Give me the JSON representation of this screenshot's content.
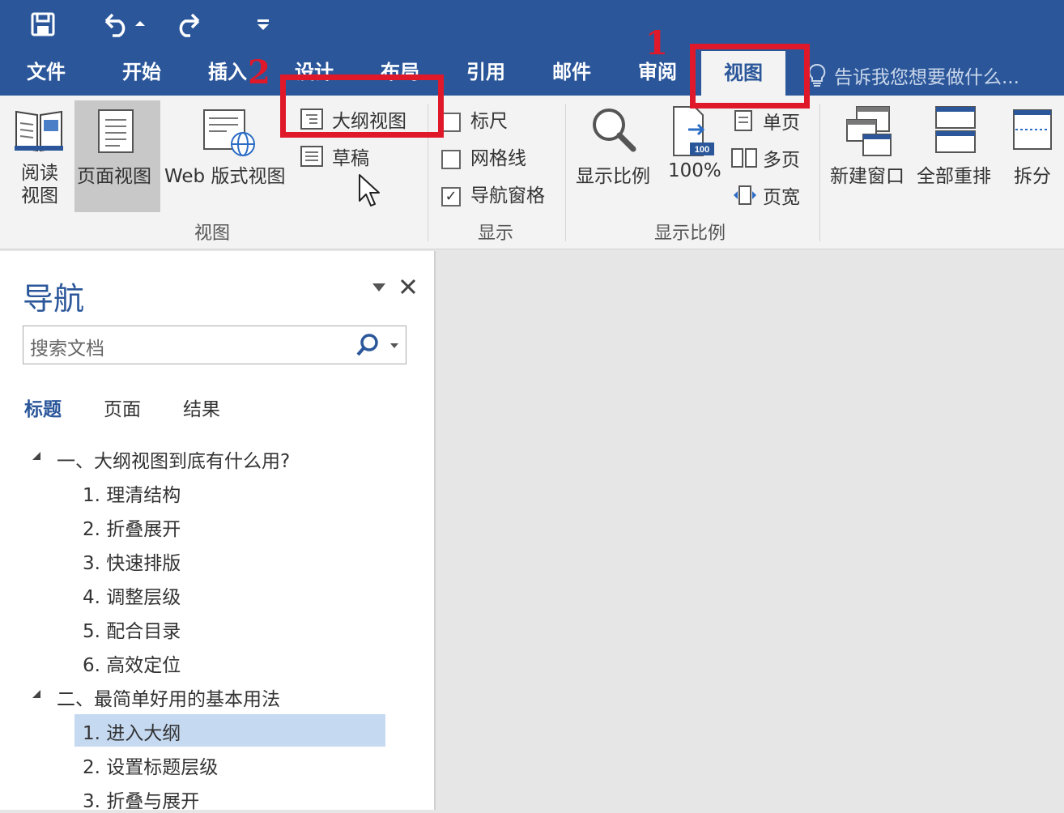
{
  "qat": {
    "save_icon": "save-icon",
    "undo_icon": "undo-icon",
    "redo_icon": "redo-icon",
    "customize_icon": "customize-icon"
  },
  "tabs": [
    {
      "label": "文件"
    },
    {
      "label": "开始"
    },
    {
      "label": "插入"
    },
    {
      "label": "设计"
    },
    {
      "label": "布局"
    },
    {
      "label": "引用"
    },
    {
      "label": "邮件"
    },
    {
      "label": "审阅"
    },
    {
      "label": "视图"
    }
  ],
  "tell_me": "告诉我您想要做什么...",
  "annotations": {
    "num1": "1",
    "num2": "2"
  },
  "ribbon": {
    "view_group": {
      "read_mode": [
        "阅读",
        "视图"
      ],
      "print_layout": "页面视图",
      "web_layout": "Web 版式视图",
      "outline": "大纲视图",
      "draft": "草稿",
      "label": "视图"
    },
    "show_group": {
      "ruler": "标尺",
      "gridlines": "网格线",
      "nav_pane": "导航窗格",
      "label": "显示"
    },
    "zoom_group": {
      "zoom": "显示比例",
      "zoom100": "100%",
      "zoom100_badge": "100",
      "one_page": "单页",
      "multi_page": "多页",
      "page_width": "页宽",
      "label": "显示比例"
    },
    "window_group": {
      "new_window": "新建窗口",
      "arrange_all": "全部重排",
      "split": "拆分"
    }
  },
  "nav": {
    "title": "导航",
    "search_placeholder": "搜索文档",
    "tabs": [
      "标题",
      "页面",
      "结果"
    ],
    "tree": [
      {
        "text": "一、大纲视图到底有什么用?"
      },
      {
        "text": "1. 理清结构"
      },
      {
        "text": "2. 折叠展开"
      },
      {
        "text": "3. 快速排版"
      },
      {
        "text": "4. 调整层级"
      },
      {
        "text": "5. 配合目录"
      },
      {
        "text": "6. 高效定位"
      },
      {
        "text": "二、最简单好用的基本用法"
      },
      {
        "text": "1. 进入大纲"
      },
      {
        "text": "2. 设置标题层级"
      },
      {
        "text": "3. 折叠与展开"
      }
    ]
  },
  "colors": {
    "accent": "#2b579a",
    "highlight": "#c5d9f1",
    "annotation": "#e0192a"
  }
}
